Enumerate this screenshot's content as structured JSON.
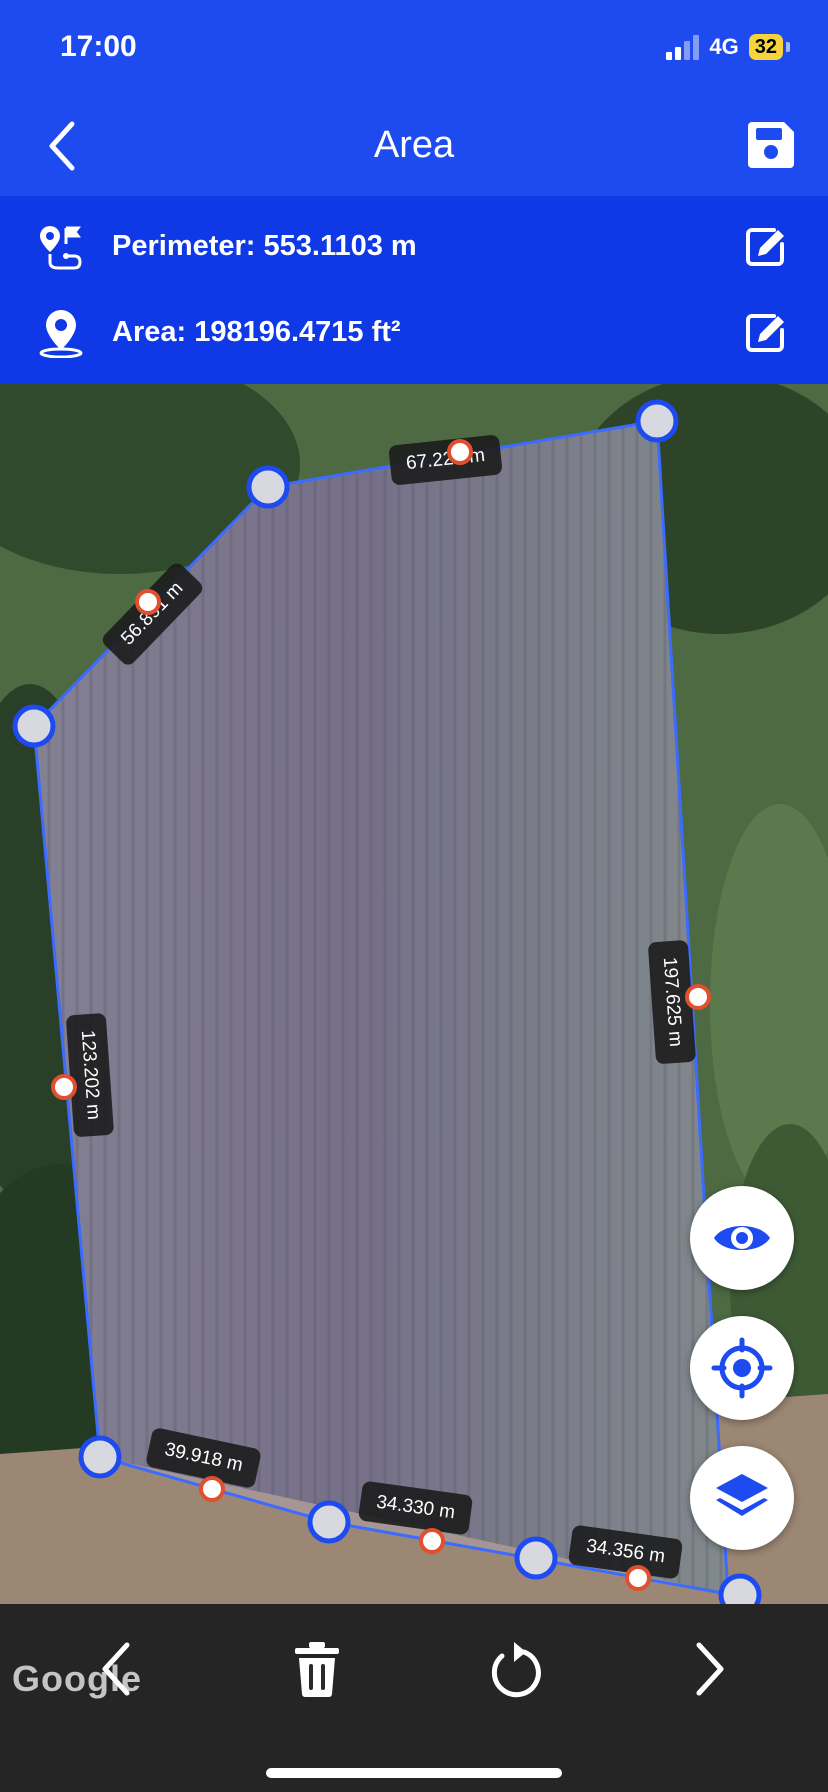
{
  "status": {
    "time": "17:00",
    "network": "4G",
    "battery": "32"
  },
  "header": {
    "title": "Area"
  },
  "measurements": {
    "perimeter": "Perimeter: 553.1103 m",
    "area": "Area: 198196.4715 ft²"
  },
  "map": {
    "provider": "Google",
    "segment_labels": [
      "67.229 m",
      "56.891 m",
      "123.202 m",
      "197.625 m",
      "39.918 m",
      "34.330 m",
      "34.356 m"
    ]
  },
  "map_controls": [
    "eye-icon",
    "locate-icon",
    "layers-icon"
  ],
  "toolbar": [
    "chevron-left-icon",
    "trash-icon",
    "undo-icon",
    "chevron-right-icon"
  ],
  "colors": {
    "primary": "#1E4BF0",
    "panel": "#0F38E6",
    "polygon": "#3C6BFF",
    "midpoint": "#E0502E",
    "battery": "#F6D43E"
  }
}
